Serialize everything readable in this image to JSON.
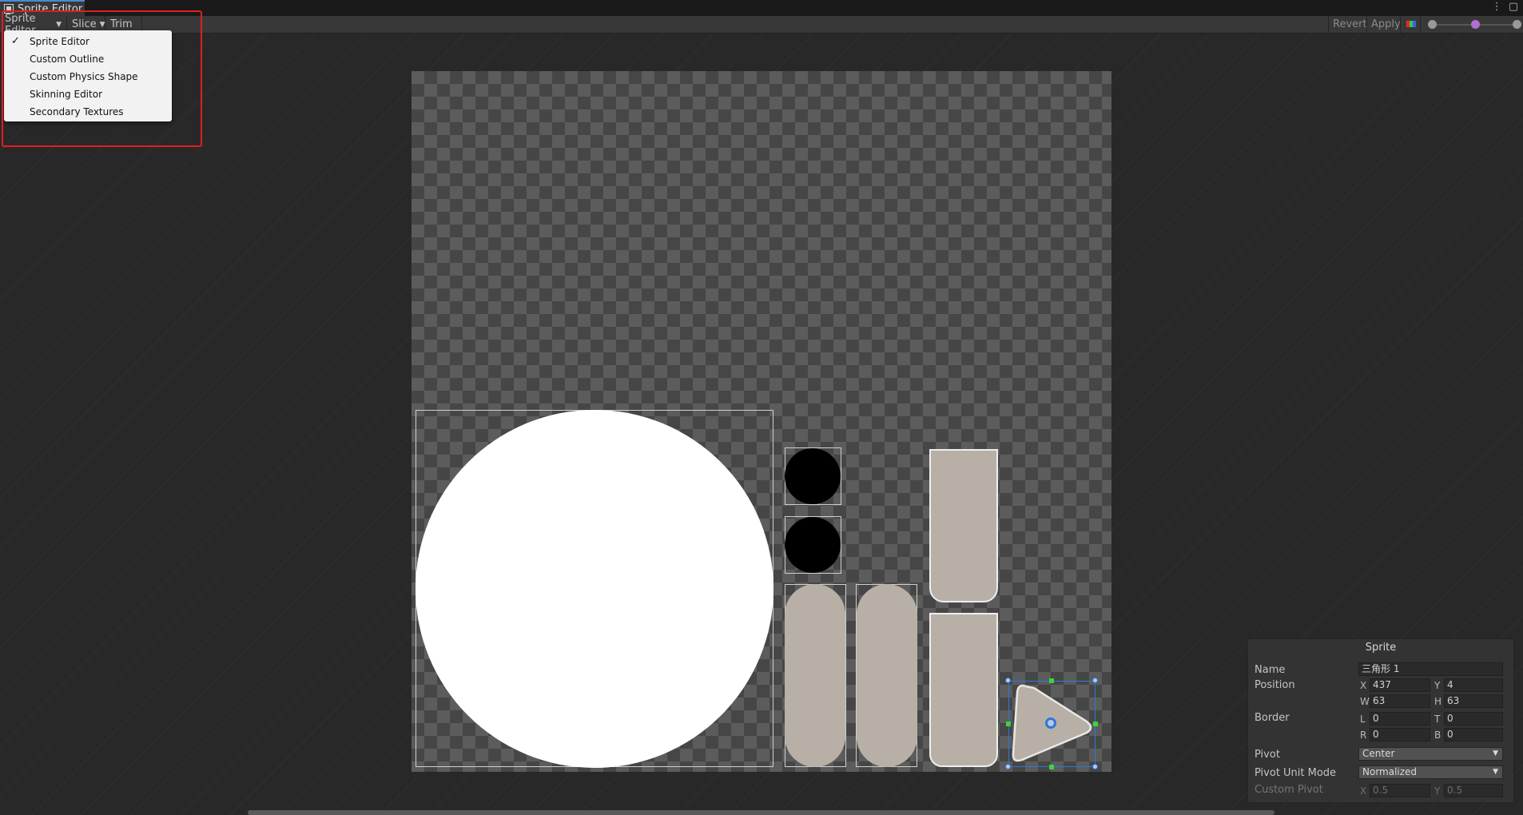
{
  "window": {
    "tab_title": "Sprite Editor",
    "more_icon": "⋮",
    "maximize_icon": "▢"
  },
  "toolbar": {
    "mode_label": "Sprite Editor",
    "slice_label": "Slice",
    "trim_label": "Trim",
    "revert_label": "Revert",
    "apply_label": "Apply"
  },
  "mode_menu": {
    "items": [
      {
        "label": "Sprite Editor",
        "checked": true
      },
      {
        "label": "Custom Outline",
        "checked": false
      },
      {
        "label": "Custom Physics Shape",
        "checked": false
      },
      {
        "label": "Skinning Editor",
        "checked": false
      },
      {
        "label": "Secondary Textures",
        "checked": false
      }
    ],
    "check_mark": "✓"
  },
  "sprite_panel": {
    "title": "Sprite",
    "name_label": "Name",
    "name_value": "三角形 1",
    "position_label": "Position",
    "x_label": "X",
    "x_value": "437",
    "y_label": "Y",
    "y_value": "4",
    "w_label": "W",
    "w_value": "63",
    "h_label": "H",
    "h_value": "63",
    "border_label": "Border",
    "l_label": "L",
    "l_value": "0",
    "t_label": "T",
    "t_value": "0",
    "r_label": "R",
    "r_value": "0",
    "b_label": "B",
    "b_value": "0",
    "pivot_label": "Pivot",
    "pivot_value": "Center",
    "pivot_unit_label": "Pivot Unit Mode",
    "pivot_unit_value": "Normalized",
    "custom_pivot_label": "Custom Pivot",
    "custom_x_label": "X",
    "custom_x_value": "0.5",
    "custom_y_label": "Y",
    "custom_y_value": "0.5"
  },
  "colors": {
    "selection_blue": "#2f76d8",
    "handle_green": "#3cd43c",
    "annotation_red": "#e21d1d",
    "sprite_beige": "#b8b0a6"
  }
}
